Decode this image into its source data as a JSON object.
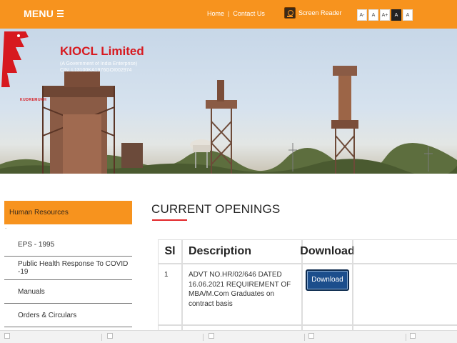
{
  "topbar": {
    "menu_label": "MENU",
    "links": [
      {
        "label": "Home"
      },
      {
        "label": "Contact Us"
      }
    ],
    "separator": "|",
    "screen_reader_label": "Screen Reader",
    "font_buttons": [
      "A-",
      "A",
      "A+",
      "A",
      "A"
    ]
  },
  "banner": {
    "company_name": "KIOCL Limited",
    "subline1": "(A Government of India Enterprise)",
    "subline2": "CIN: L13100KA1976GOI002974",
    "logo_mark": "KUDREMUKH"
  },
  "sidebar": {
    "active": "Human Resources",
    "dot": ".",
    "items": [
      {
        "label": "EPS - 1995"
      },
      {
        "label": "Public Health Response To COVID -19"
      },
      {
        "label": "Manuals"
      },
      {
        "label": "Orders & Circulars"
      }
    ]
  },
  "main": {
    "title": "CURRENT OPENINGS",
    "table": {
      "headers": [
        "Sl",
        "Description",
        "Download"
      ],
      "rows": [
        {
          "sl": "1",
          "description": "ADVT NO.HR/02/646 DATED 16.06.2021 REQUIREMENT OF MBA/M.Com Graduates on contract basis",
          "download_label": "Download"
        }
      ]
    }
  },
  "colors": {
    "accent": "#f7931e",
    "brand_red": "#d7191f",
    "button_blue": "#1c4e8c"
  }
}
